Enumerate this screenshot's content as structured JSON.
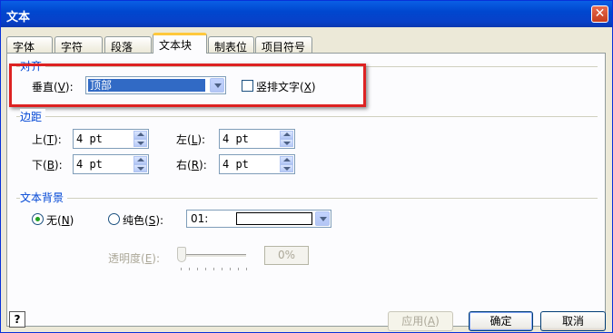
{
  "window": {
    "title": "文本"
  },
  "tabs": [
    "字体",
    "字符",
    "段落",
    "文本块",
    "制表位",
    "项目符号"
  ],
  "alignment": {
    "group_title": "对齐",
    "vertical_label": "垂直(",
    "vertical_key": "V",
    "vertical_suffix": "):",
    "vertical_value": "顶部",
    "vertical_text_label": "竖排文字(",
    "vertical_text_key": "X",
    "vertical_text_suffix": ")",
    "vertical_text_checked": false
  },
  "margins": {
    "group_title": "边距",
    "top": {
      "label": "上(",
      "key": "T",
      "suffix": "):",
      "value": "4 pt"
    },
    "bottom": {
      "label": "下(",
      "key": "B",
      "suffix": "):",
      "value": "4 pt"
    },
    "left": {
      "label": "左(",
      "key": "L",
      "suffix": "):",
      "value": "4 pt"
    },
    "right": {
      "label": "右(",
      "key": "R",
      "suffix": "):",
      "value": "4 pt"
    }
  },
  "background": {
    "group_title": "文本背景",
    "none_label": "无(",
    "none_key": "N",
    "none_suffix": ")",
    "solid_label": "纯色(",
    "solid_key": "S",
    "solid_suffix": "):",
    "color_value": "01:",
    "selected": "none",
    "transparency_label": "透明度(",
    "transparency_key": "E",
    "transparency_suffix": "):",
    "transparency_value": "0%",
    "transparency_level": 0
  },
  "buttons": {
    "help": "?",
    "apply_label": "应用(",
    "apply_key": "A",
    "apply_suffix": ")",
    "ok": "确定",
    "cancel": "取消"
  },
  "colors": {
    "highlight_box": "#dd2222",
    "group_title": "#0046d5",
    "selection": "#316ac5"
  }
}
